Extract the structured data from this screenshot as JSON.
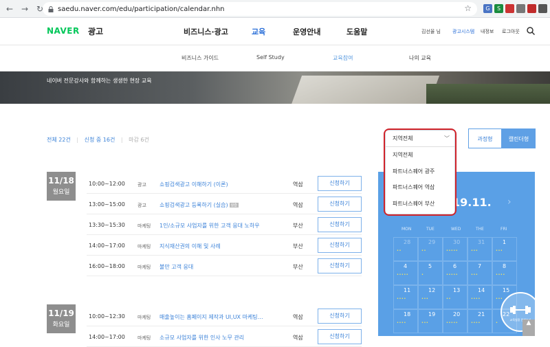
{
  "browser": {
    "url": "saedu.naver.com/edu/participation/calendar.nhn",
    "extensions": [
      {
        "label": "G",
        "color": "#4a74c4"
      },
      {
        "label": "S",
        "color": "#1a8c3e"
      },
      {
        "label": "",
        "color": "#cc3333"
      },
      {
        "label": "",
        "color": "#777777"
      },
      {
        "label": "",
        "color": "#c02b2b"
      },
      {
        "label": "",
        "color": "#555555"
      }
    ]
  },
  "header": {
    "logo": "NAVER",
    "logo_sub": "광고",
    "menu": [
      "비즈니스·광고",
      "교육",
      "운영안내",
      "도움말"
    ],
    "active_menu": "교육",
    "user": "김선율 님",
    "util": [
      "광고시스템",
      "내정보",
      "로그아웃"
    ]
  },
  "subnav": {
    "items": [
      "비즈니스 가이드",
      "Self Study",
      "교육참여",
      "나의 교육"
    ],
    "active": "교육참여"
  },
  "hero": {
    "caption": "네이버 전문강사와 함께하는 생생한 현장 교육"
  },
  "summary": {
    "total": "전체 22건",
    "open": "신청 중 16건",
    "closed": "마감 6건"
  },
  "view_toggle": {
    "list": "과정형",
    "calendar": "캘린더형"
  },
  "region_dropdown": {
    "selected": "지역전체",
    "options": [
      "지역전체",
      "파트너스퀘어 광주",
      "파트너스퀘어 역삼",
      "파트너스퀘어 부산"
    ]
  },
  "calendar": {
    "month": "19.11.",
    "weekdays": [
      "MON",
      "TUE",
      "WED",
      "THE",
      "FRI"
    ],
    "weeks": [
      [
        {
          "d": "28",
          "dim": true,
          "dots": "••"
        },
        {
          "d": "29",
          "dim": true,
          "dots": "••"
        },
        {
          "d": "30",
          "dim": true,
          "dots": "•••••"
        },
        {
          "d": "31",
          "dim": true,
          "dots": "•••"
        },
        {
          "d": "1",
          "dim": false,
          "dots": "•••"
        }
      ],
      [
        {
          "d": "4",
          "dim": false,
          "dots": "•••••"
        },
        {
          "d": "5",
          "dim": false,
          "dots": "•"
        },
        {
          "d": "6",
          "dim": false,
          "dots": "•••••"
        },
        {
          "d": "7",
          "dim": false,
          "dots": "•••"
        },
        {
          "d": "8",
          "dim": false,
          "dots": "••••"
        }
      ],
      [
        {
          "d": "11",
          "dim": false,
          "dots": "••••"
        },
        {
          "d": "12",
          "dim": false,
          "dots": "•••"
        },
        {
          "d": "13",
          "dim": false,
          "dots": "••"
        },
        {
          "d": "14",
          "dim": false,
          "dots": "••••"
        },
        {
          "d": "15",
          "dim": false,
          "dots": "•••"
        }
      ],
      [
        {
          "d": "18",
          "dim": false,
          "dots": "••••"
        },
        {
          "d": "19",
          "dim": false,
          "dots": "•••"
        },
        {
          "d": "20",
          "dim": false,
          "dots": "•••••"
        },
        {
          "d": "21",
          "dim": false,
          "dots": "••••"
        },
        {
          "d": "22",
          "dim": false,
          "dots": "•"
        }
      ]
    ]
  },
  "days": [
    {
      "date": "11/18",
      "weekday": "월요일",
      "sessions": [
        {
          "time": "10:00~12:00",
          "cat": "광고",
          "title": "쇼핑검색광고 이해하기 (이론)",
          "tag": "",
          "loc": "역삼",
          "btn": "신청하기"
        },
        {
          "time": "13:00~15:00",
          "cat": "광고",
          "title": "쇼핑검색광고 등록하기 (실습)",
          "tag": "실습",
          "loc": "역삼",
          "btn": "신청하기"
        },
        {
          "time": "13:30~15:30",
          "cat": "마케팅",
          "title": "1인/소규모 사업자를 위한 고객 응대 노하우",
          "tag": "",
          "loc": "부산",
          "btn": "신청하기"
        },
        {
          "time": "14:00~17:00",
          "cat": "마케팅",
          "title": "지식재산권의 이해 및 사례",
          "tag": "",
          "loc": "부산",
          "btn": "신청하기"
        },
        {
          "time": "16:00~18:00",
          "cat": "마케팅",
          "title": "불만 고객 응대",
          "tag": "",
          "loc": "부산",
          "btn": "신청하기"
        }
      ]
    },
    {
      "date": "11/19",
      "weekday": "화요일",
      "sessions": [
        {
          "time": "10:00~12:30",
          "cat": "마케팅",
          "title": "매출높이는 홈페이지 제작과 UI,UX 마케팅…",
          "tag": "",
          "loc": "역삼",
          "btn": "신청하기"
        },
        {
          "time": "14:00~17:00",
          "cat": "마케팅",
          "title": "소규모 사업자를 위한 인사 노무 관리",
          "tag": "",
          "loc": "역삼",
          "btn": "신청하기"
        }
      ]
    }
  ],
  "floating": {
    "scroll_label": "교육일정 전체보기"
  }
}
